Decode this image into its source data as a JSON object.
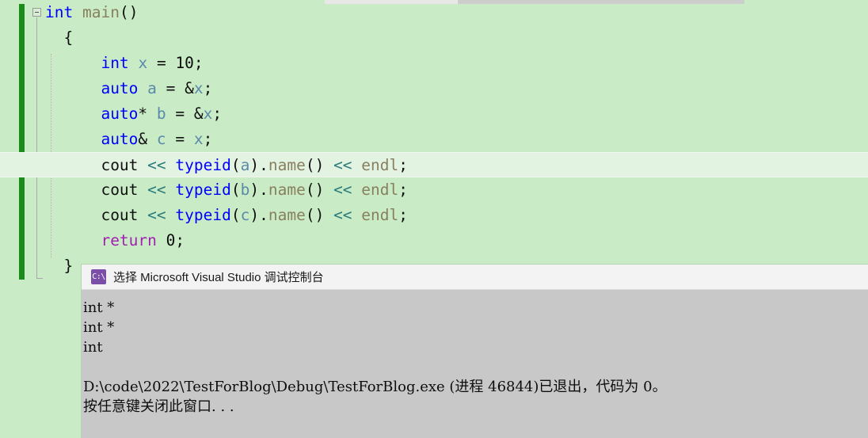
{
  "editor": {
    "background_color": "#c9ecc7",
    "change_bar_color": "#1a8c1a",
    "current_line_background": "#e3f3e1",
    "fold_icon": "collapse-minus-icon",
    "code_lines": [
      {
        "id": "line-1",
        "current": false,
        "tokens": [
          {
            "text": "int",
            "cls": "kw"
          },
          {
            "text": " ",
            "cls": "plain"
          },
          {
            "text": "main",
            "cls": "fn"
          },
          {
            "text": "()",
            "cls": "punct"
          }
        ]
      },
      {
        "id": "line-2",
        "current": false,
        "tokens": [
          {
            "text": "  {",
            "cls": "punct"
          }
        ]
      },
      {
        "id": "line-3",
        "current": false,
        "tokens": [
          {
            "text": "      ",
            "cls": "plain"
          },
          {
            "text": "int",
            "cls": "kw"
          },
          {
            "text": " ",
            "cls": "plain"
          },
          {
            "text": "x",
            "cls": "var"
          },
          {
            "text": " ",
            "cls": "plain"
          },
          {
            "text": "=",
            "cls": "punct"
          },
          {
            "text": " ",
            "cls": "plain"
          },
          {
            "text": "10",
            "cls": "num"
          },
          {
            "text": ";",
            "cls": "punct"
          }
        ]
      },
      {
        "id": "line-4",
        "current": false,
        "tokens": [
          {
            "text": "      ",
            "cls": "plain"
          },
          {
            "text": "auto",
            "cls": "kw"
          },
          {
            "text": " ",
            "cls": "plain"
          },
          {
            "text": "a",
            "cls": "var"
          },
          {
            "text": " ",
            "cls": "plain"
          },
          {
            "text": "=",
            "cls": "punct"
          },
          {
            "text": " ",
            "cls": "plain"
          },
          {
            "text": "&",
            "cls": "punct"
          },
          {
            "text": "x",
            "cls": "var"
          },
          {
            "text": ";",
            "cls": "punct"
          }
        ]
      },
      {
        "id": "line-5",
        "current": false,
        "tokens": [
          {
            "text": "      ",
            "cls": "plain"
          },
          {
            "text": "auto",
            "cls": "kw"
          },
          {
            "text": "*",
            "cls": "punct"
          },
          {
            "text": " ",
            "cls": "plain"
          },
          {
            "text": "b",
            "cls": "var"
          },
          {
            "text": " ",
            "cls": "plain"
          },
          {
            "text": "=",
            "cls": "punct"
          },
          {
            "text": " ",
            "cls": "plain"
          },
          {
            "text": "&",
            "cls": "punct"
          },
          {
            "text": "x",
            "cls": "var"
          },
          {
            "text": ";",
            "cls": "punct"
          }
        ]
      },
      {
        "id": "line-6",
        "current": false,
        "tokens": [
          {
            "text": "      ",
            "cls": "plain"
          },
          {
            "text": "auto",
            "cls": "kw"
          },
          {
            "text": "&",
            "cls": "punct"
          },
          {
            "text": " ",
            "cls": "plain"
          },
          {
            "text": "c",
            "cls": "var"
          },
          {
            "text": " ",
            "cls": "plain"
          },
          {
            "text": "=",
            "cls": "punct"
          },
          {
            "text": " ",
            "cls": "plain"
          },
          {
            "text": "x",
            "cls": "var"
          },
          {
            "text": ";",
            "cls": "punct"
          }
        ]
      },
      {
        "id": "line-7",
        "current": true,
        "tokens": [
          {
            "text": "      ",
            "cls": "plain"
          },
          {
            "text": "cout",
            "cls": "plain"
          },
          {
            "text": " ",
            "cls": "plain"
          },
          {
            "text": "<<",
            "cls": "op"
          },
          {
            "text": " ",
            "cls": "plain"
          },
          {
            "text": "typeid",
            "cls": "kw"
          },
          {
            "text": "(",
            "cls": "punct"
          },
          {
            "text": "a",
            "cls": "var"
          },
          {
            "text": ")",
            "cls": "punct"
          },
          {
            "text": ".",
            "cls": "punct"
          },
          {
            "text": "name",
            "cls": "fn"
          },
          {
            "text": "()",
            "cls": "punct"
          },
          {
            "text": " ",
            "cls": "plain"
          },
          {
            "text": "<<",
            "cls": "op"
          },
          {
            "text": " ",
            "cls": "plain"
          },
          {
            "text": "endl",
            "cls": "fn"
          },
          {
            "text": ";",
            "cls": "punct"
          }
        ]
      },
      {
        "id": "line-8",
        "current": false,
        "tokens": [
          {
            "text": "      ",
            "cls": "plain"
          },
          {
            "text": "cout",
            "cls": "plain"
          },
          {
            "text": " ",
            "cls": "plain"
          },
          {
            "text": "<<",
            "cls": "op"
          },
          {
            "text": " ",
            "cls": "plain"
          },
          {
            "text": "typeid",
            "cls": "kw"
          },
          {
            "text": "(",
            "cls": "punct"
          },
          {
            "text": "b",
            "cls": "var"
          },
          {
            "text": ")",
            "cls": "punct"
          },
          {
            "text": ".",
            "cls": "punct"
          },
          {
            "text": "name",
            "cls": "fn"
          },
          {
            "text": "()",
            "cls": "punct"
          },
          {
            "text": " ",
            "cls": "plain"
          },
          {
            "text": "<<",
            "cls": "op"
          },
          {
            "text": " ",
            "cls": "plain"
          },
          {
            "text": "endl",
            "cls": "fn"
          },
          {
            "text": ";",
            "cls": "punct"
          }
        ]
      },
      {
        "id": "line-9",
        "current": false,
        "tokens": [
          {
            "text": "      ",
            "cls": "plain"
          },
          {
            "text": "cout",
            "cls": "plain"
          },
          {
            "text": " ",
            "cls": "plain"
          },
          {
            "text": "<<",
            "cls": "op"
          },
          {
            "text": " ",
            "cls": "plain"
          },
          {
            "text": "typeid",
            "cls": "kw"
          },
          {
            "text": "(",
            "cls": "punct"
          },
          {
            "text": "c",
            "cls": "var"
          },
          {
            "text": ")",
            "cls": "punct"
          },
          {
            "text": ".",
            "cls": "punct"
          },
          {
            "text": "name",
            "cls": "fn"
          },
          {
            "text": "()",
            "cls": "punct"
          },
          {
            "text": " ",
            "cls": "plain"
          },
          {
            "text": "<<",
            "cls": "op"
          },
          {
            "text": " ",
            "cls": "plain"
          },
          {
            "text": "endl",
            "cls": "fn"
          },
          {
            "text": ";",
            "cls": "punct"
          }
        ]
      },
      {
        "id": "line-10",
        "current": false,
        "tokens": [
          {
            "text": "      ",
            "cls": "plain"
          },
          {
            "text": "return",
            "cls": "ret"
          },
          {
            "text": " ",
            "cls": "plain"
          },
          {
            "text": "0",
            "cls": "num"
          },
          {
            "text": ";",
            "cls": "punct"
          }
        ]
      },
      {
        "id": "line-11",
        "current": false,
        "tokens": [
          {
            "text": "  }",
            "cls": "punct"
          }
        ]
      }
    ]
  },
  "console": {
    "icon_name": "console-window-icon",
    "icon_text": "C:\\",
    "title": "选择 Microsoft Visual Studio 调试控制台",
    "output_lines": [
      "int *",
      "int *",
      "int",
      "",
      "D:\\code\\2022\\TestForBlog\\Debug\\TestForBlog.exe (进程 46844)已退出，代码为 0。",
      "按任意键关闭此窗口. . ."
    ]
  }
}
